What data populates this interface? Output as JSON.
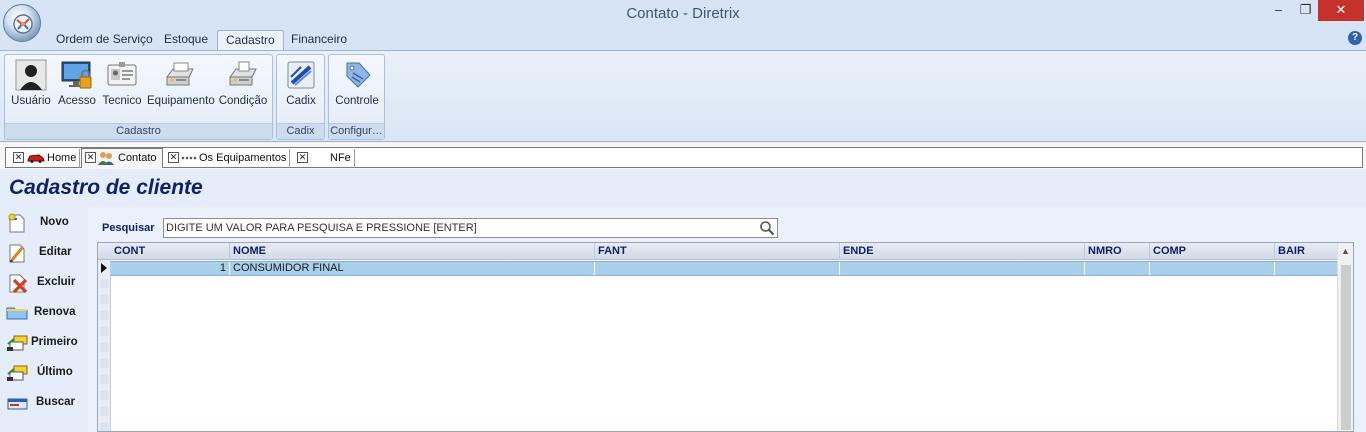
{
  "window": {
    "title": "Contato - Diretrix",
    "minimize_glyph": "‒",
    "maximize_glyph": "❐",
    "close_glyph": "✕"
  },
  "menu": {
    "tabs": [
      {
        "label": "Ordem de Serviço"
      },
      {
        "label": "Estoque"
      },
      {
        "label": "Cadastro",
        "active": true
      },
      {
        "label": "Financeiro"
      }
    ],
    "help_glyph": "?"
  },
  "ribbon": {
    "groups": [
      {
        "label": "Cadastro",
        "buttons": [
          {
            "label": "Usuário",
            "icon": "user-icon"
          },
          {
            "label": "Acesso",
            "icon": "monitor-lock-icon"
          },
          {
            "label": "Tecnico",
            "icon": "id-card-icon"
          },
          {
            "label": "Equipamento",
            "icon": "printer-icon"
          },
          {
            "label": "Condição",
            "icon": "cash-register-icon"
          }
        ]
      },
      {
        "label": "Cadix",
        "buttons": [
          {
            "label": "Cadix",
            "icon": "cadix-icon"
          }
        ]
      },
      {
        "label": "Configur…",
        "buttons": [
          {
            "label": "Controle",
            "icon": "tag-icon"
          }
        ]
      }
    ]
  },
  "doc_tabs": [
    {
      "label": "Home",
      "close": "✕",
      "icon": "car-icon"
    },
    {
      "label": "Contato",
      "close": "✕",
      "icon": "people-icon",
      "active": true
    },
    {
      "label": "Os Equipamentos",
      "close": "✕",
      "icon": "dots-icon"
    },
    {
      "label": "NFe",
      "close": "✕"
    }
  ],
  "page": {
    "title": "Cadastro de cliente"
  },
  "sidebar": {
    "buttons": [
      {
        "label": "Novo",
        "icon": "new-document-icon"
      },
      {
        "label": "Editar",
        "icon": "edit-document-icon"
      },
      {
        "label": "Excluir",
        "icon": "delete-icon"
      },
      {
        "label": "Renova",
        "icon": "folder-refresh-icon"
      },
      {
        "label": "Primeiro",
        "icon": "first-record-icon"
      },
      {
        "label": "Último",
        "icon": "last-record-icon"
      },
      {
        "label": "Buscar",
        "icon": "search-card-icon"
      }
    ]
  },
  "search": {
    "label": "Pesquisar",
    "value": "DIGITE UM VALOR PARA PESQUISA E PRESSIONE [ENTER]"
  },
  "grid": {
    "columns": [
      "CONT",
      "NOME",
      "FANT",
      "ENDE",
      "NMRO",
      "COMP",
      "BAIR"
    ],
    "rows": [
      {
        "cells": [
          "1",
          "CONSUMIDOR FINAL",
          "",
          "",
          "",
          "",
          ""
        ],
        "selected": true
      }
    ],
    "scroll_up_glyph": "▲"
  },
  "colors": {
    "title_blue": "#10206b",
    "ribbon_bg": "#dae6f5",
    "selected_row": "#a9cfea",
    "close_red": "#c7312b"
  }
}
